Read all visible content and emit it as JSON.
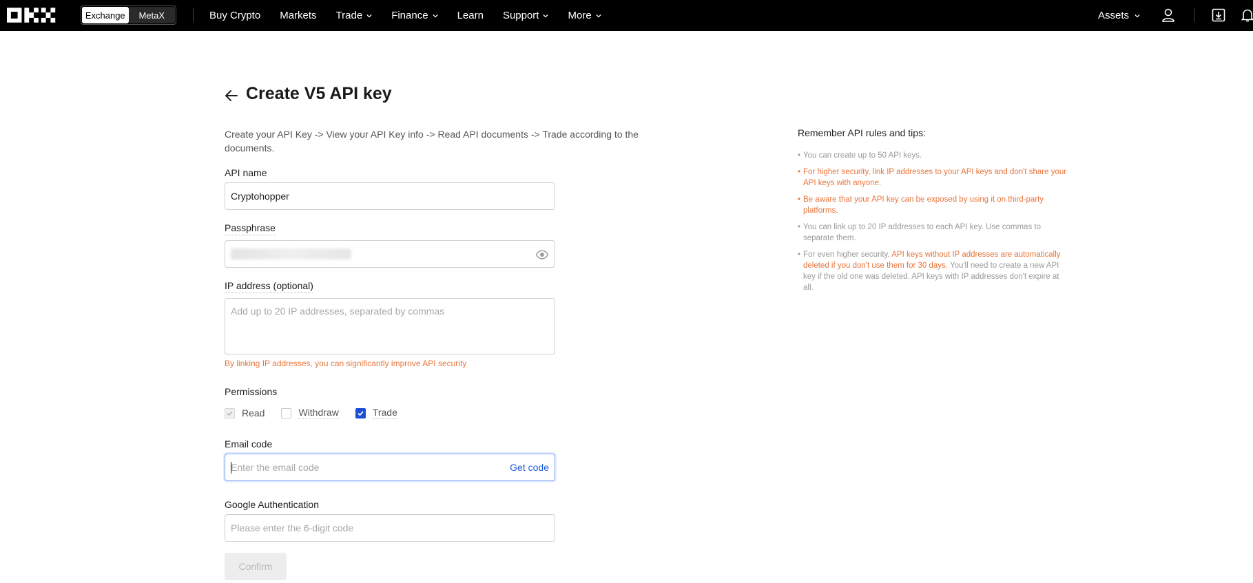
{
  "header": {
    "segment": {
      "active": "Exchange",
      "inactive": "MetaX"
    },
    "nav": [
      {
        "label": "Buy Crypto",
        "dropdown": false
      },
      {
        "label": "Markets",
        "dropdown": false
      },
      {
        "label": "Trade",
        "dropdown": true
      },
      {
        "label": "Finance",
        "dropdown": true
      },
      {
        "label": "Learn",
        "dropdown": false
      },
      {
        "label": "Support",
        "dropdown": true
      },
      {
        "label": "More",
        "dropdown": true
      }
    ],
    "assets_label": "Assets",
    "icons": [
      "logo-icon",
      "user-icon",
      "download-icon",
      "bell-icon"
    ]
  },
  "page": {
    "title": "Create V5 API key",
    "flow_text": "Create your API Key -> View your API Key info -> Read API documents -> Trade according to the documents."
  },
  "form": {
    "api_name": {
      "label": "API name",
      "value": "Cryptohopper"
    },
    "passphrase": {
      "label": "Passphrase"
    },
    "ip": {
      "label": "IP address (optional)",
      "placeholder": "Add up to 20 IP addresses, separated by commas",
      "hint": "By linking IP addresses, you can significantly improve API security"
    },
    "permissions": {
      "label": "Permissions",
      "items": [
        {
          "label": "Read",
          "state": "checked-disabled"
        },
        {
          "label": "Withdraw",
          "state": "unchecked"
        },
        {
          "label": "Trade",
          "state": "checked"
        }
      ]
    },
    "email_code": {
      "label": "Email code",
      "placeholder": "Enter the email code",
      "action": "Get code"
    },
    "google_auth": {
      "label": "Google Authentication",
      "placeholder": "Please enter the 6-digit code"
    },
    "confirm_label": "Confirm"
  },
  "tips": {
    "title": "Remember API rules and tips:",
    "items": [
      {
        "text": "You can create up to 50 API keys.",
        "style": "gray"
      },
      {
        "text": "For higher security, link IP addresses to your API keys and don't share your API keys with anyone.",
        "style": "orange"
      },
      {
        "text": "Be aware that your API key can be exposed by using it on third-party platforms.",
        "style": "orange"
      },
      {
        "text": "You can link up to 20 IP addresses to each API key. Use commas to separate them.",
        "style": "gray"
      },
      {
        "style": "mixed",
        "part1": "For even higher security, ",
        "part2": "API keys without IP addresses are automatically deleted if you don't use them for 30 days.",
        "part3": " You'll need to create a new API key if the old one was deleted. API keys with IP addresses don't expire at all."
      }
    ]
  },
  "colors": {
    "accent": "#1d5bd8",
    "warning": "#e8743b",
    "nav_bg": "#000000"
  }
}
